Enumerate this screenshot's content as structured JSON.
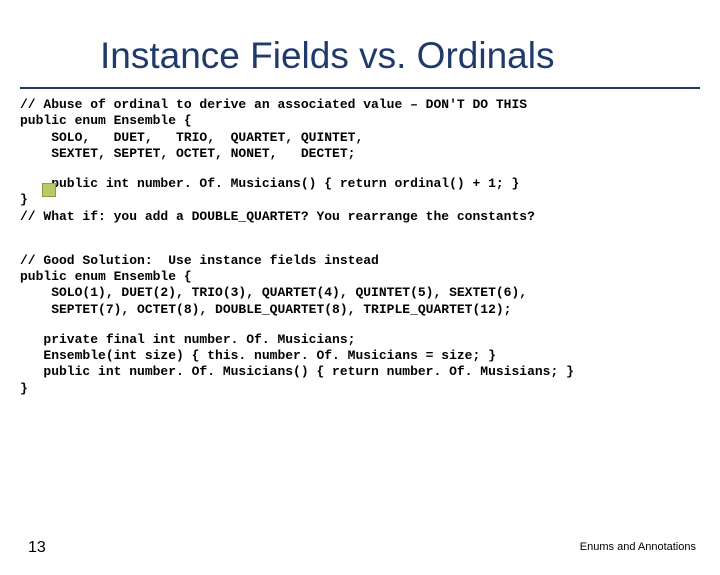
{
  "title": "Instance Fields vs. Ordinals",
  "code1": "// Abuse of ordinal to derive an associated value – DON'T DO THIS\npublic enum Ensemble {\n    SOLO,   DUET,   TRIO,  QUARTET, QUINTET,\n    SEXTET, SEPTET, OCTET, NONET,   DECTET;",
  "code2": "    public int number. Of. Musicians() { return ordinal() + 1; }\n}\n// What if: you add a DOUBLE_QUARTET? You rearrange the constants?",
  "code3": "// Good Solution:  Use instance fields instead\npublic enum Ensemble {\n    SOLO(1), DUET(2), TRIO(3), QUARTET(4), QUINTET(5), SEXTET(6),\n    SEPTET(7), OCTET(8), DOUBLE_QUARTET(8), TRIPLE_QUARTET(12);",
  "code4": "   private final int number. Of. Musicians;\n   Ensemble(int size) { this. number. Of. Musicians = size; }\n   public int number. Of. Musicians() { return number. Of. Musisians; }\n}",
  "page_number": "13",
  "footer": "Enums and Annotations"
}
